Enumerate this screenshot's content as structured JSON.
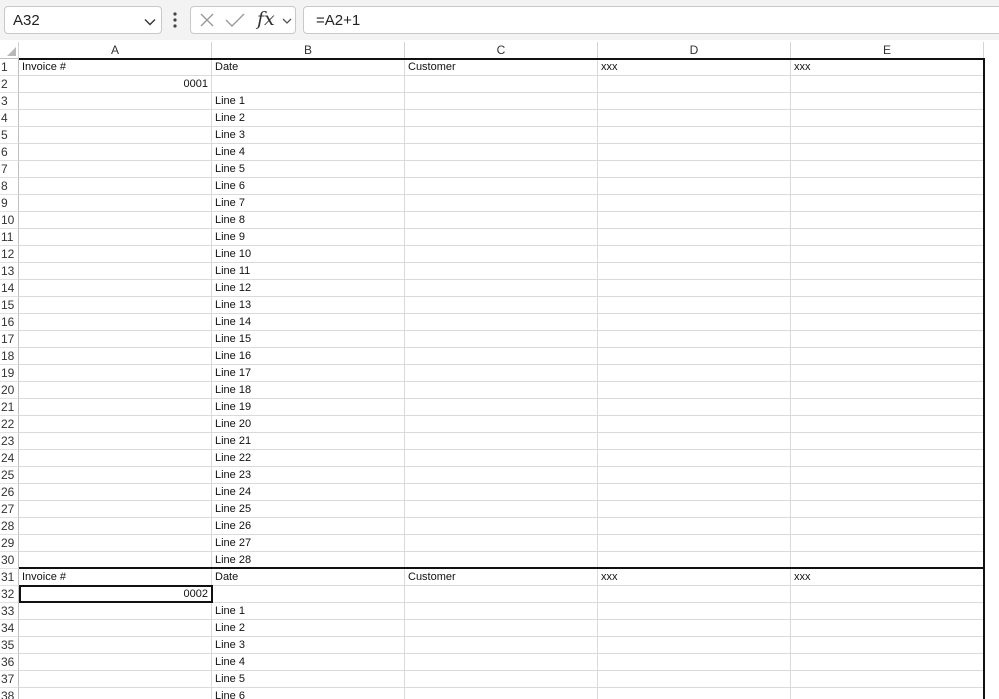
{
  "formula_bar": {
    "name_box": "A32",
    "formula": "=A2+1",
    "fx_label": "fx"
  },
  "icons": {
    "name_box_dropdown": "chevron-down-icon",
    "more": "vertical-dots-icon",
    "cancel": "close-icon",
    "enter": "check-icon",
    "fx_dropdown": "chevron-down-icon"
  },
  "columns": [
    "A",
    "B",
    "C",
    "D",
    "E"
  ],
  "rows": [
    {
      "n": "1",
      "cells": [
        "Invoice #",
        "Date",
        "Customer",
        "xxx",
        "xxx"
      ]
    },
    {
      "n": "2",
      "cells": [
        "0001",
        "",
        "",
        "",
        ""
      ]
    },
    {
      "n": "3",
      "cells": [
        "",
        "Line 1",
        "",
        "",
        ""
      ]
    },
    {
      "n": "4",
      "cells": [
        "",
        "Line 2",
        "",
        "",
        ""
      ]
    },
    {
      "n": "5",
      "cells": [
        "",
        "Line 3",
        "",
        "",
        ""
      ]
    },
    {
      "n": "6",
      "cells": [
        "",
        "Line 4",
        "",
        "",
        ""
      ]
    },
    {
      "n": "7",
      "cells": [
        "",
        "Line 5",
        "",
        "",
        ""
      ]
    },
    {
      "n": "8",
      "cells": [
        "",
        "Line 6",
        "",
        "",
        ""
      ]
    },
    {
      "n": "9",
      "cells": [
        "",
        "Line 7",
        "",
        "",
        ""
      ]
    },
    {
      "n": "10",
      "cells": [
        "",
        "Line 8",
        "",
        "",
        ""
      ]
    },
    {
      "n": "11",
      "cells": [
        "",
        "Line 9",
        "",
        "",
        ""
      ]
    },
    {
      "n": "12",
      "cells": [
        "",
        "Line 10",
        "",
        "",
        ""
      ]
    },
    {
      "n": "13",
      "cells": [
        "",
        "Line 11",
        "",
        "",
        ""
      ]
    },
    {
      "n": "14",
      "cells": [
        "",
        "Line 12",
        "",
        "",
        ""
      ]
    },
    {
      "n": "15",
      "cells": [
        "",
        "Line 13",
        "",
        "",
        ""
      ]
    },
    {
      "n": "16",
      "cells": [
        "",
        "Line 14",
        "",
        "",
        ""
      ]
    },
    {
      "n": "17",
      "cells": [
        "",
        "Line 15",
        "",
        "",
        ""
      ]
    },
    {
      "n": "18",
      "cells": [
        "",
        "Line 16",
        "",
        "",
        ""
      ]
    },
    {
      "n": "19",
      "cells": [
        "",
        "Line 17",
        "",
        "",
        ""
      ]
    },
    {
      "n": "20",
      "cells": [
        "",
        "Line 18",
        "",
        "",
        ""
      ]
    },
    {
      "n": "21",
      "cells": [
        "",
        "Line 19",
        "",
        "",
        ""
      ]
    },
    {
      "n": "22",
      "cells": [
        "",
        "Line 20",
        "",
        "",
        ""
      ]
    },
    {
      "n": "23",
      "cells": [
        "",
        "Line 21",
        "",
        "",
        ""
      ]
    },
    {
      "n": "24",
      "cells": [
        "",
        "Line 22",
        "",
        "",
        ""
      ]
    },
    {
      "n": "25",
      "cells": [
        "",
        "Line 23",
        "",
        "",
        ""
      ]
    },
    {
      "n": "26",
      "cells": [
        "",
        "Line 24",
        "",
        "",
        ""
      ]
    },
    {
      "n": "27",
      "cells": [
        "",
        "Line 25",
        "",
        "",
        ""
      ]
    },
    {
      "n": "28",
      "cells": [
        "",
        "Line 26",
        "",
        "",
        ""
      ]
    },
    {
      "n": "29",
      "cells": [
        "",
        "Line 27",
        "",
        "",
        ""
      ]
    },
    {
      "n": "30",
      "cells": [
        "",
        "Line 28",
        "",
        "",
        ""
      ]
    },
    {
      "n": "31",
      "cells": [
        "Invoice #",
        "Date",
        "Customer",
        "xxx",
        "xxx"
      ]
    },
    {
      "n": "32",
      "cells": [
        "0002",
        "",
        "",
        "",
        ""
      ]
    },
    {
      "n": "33",
      "cells": [
        "",
        "Line 1",
        "",
        "",
        ""
      ]
    },
    {
      "n": "34",
      "cells": [
        "",
        "Line 2",
        "",
        "",
        ""
      ]
    },
    {
      "n": "35",
      "cells": [
        "",
        "Line 3",
        "",
        "",
        ""
      ]
    },
    {
      "n": "36",
      "cells": [
        "",
        "Line 4",
        "",
        "",
        ""
      ]
    },
    {
      "n": "37",
      "cells": [
        "",
        "Line 5",
        "",
        "",
        ""
      ]
    },
    {
      "n": "38",
      "cells": [
        "",
        "Line 6",
        "",
        "",
        ""
      ]
    }
  ],
  "selected_cell": "A32",
  "colors": {
    "selection": "#107c41",
    "toolbar_bg": "#f3f3f3",
    "border_thick": "#111111"
  }
}
